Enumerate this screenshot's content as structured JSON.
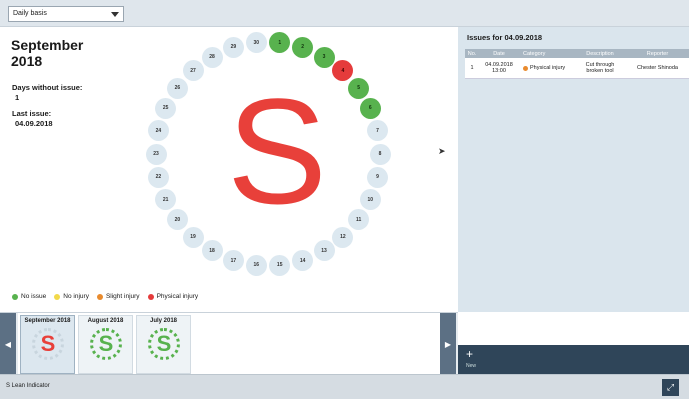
{
  "toolbar": {
    "period_select": "Daily basis"
  },
  "summary": {
    "month_line1": "September",
    "month_line2": "2018",
    "days_without_issue_label": "Days without issue:",
    "days_without_issue_value": "1",
    "last_issue_label": "Last issue:",
    "last_issue_value": "04.09.2018",
    "big_letter": "S"
  },
  "days": [
    {
      "n": "1",
      "status": "green"
    },
    {
      "n": "2",
      "status": "green"
    },
    {
      "n": "3",
      "status": "green"
    },
    {
      "n": "4",
      "status": "red"
    },
    {
      "n": "5",
      "status": "green"
    },
    {
      "n": "6",
      "status": "green"
    },
    {
      "n": "7",
      "status": "none"
    },
    {
      "n": "8",
      "status": "none"
    },
    {
      "n": "9",
      "status": "none"
    },
    {
      "n": "10",
      "status": "none"
    },
    {
      "n": "11",
      "status": "none"
    },
    {
      "n": "12",
      "status": "none"
    },
    {
      "n": "13",
      "status": "none"
    },
    {
      "n": "14",
      "status": "none"
    },
    {
      "n": "15",
      "status": "none"
    },
    {
      "n": "16",
      "status": "none"
    },
    {
      "n": "17",
      "status": "none"
    },
    {
      "n": "18",
      "status": "none"
    },
    {
      "n": "19",
      "status": "none"
    },
    {
      "n": "20",
      "status": "none"
    },
    {
      "n": "21",
      "status": "none"
    },
    {
      "n": "22",
      "status": "none"
    },
    {
      "n": "23",
      "status": "none"
    },
    {
      "n": "24",
      "status": "none"
    },
    {
      "n": "25",
      "status": "none"
    },
    {
      "n": "26",
      "status": "none"
    },
    {
      "n": "27",
      "status": "none"
    },
    {
      "n": "28",
      "status": "none"
    },
    {
      "n": "29",
      "status": "none"
    },
    {
      "n": "30",
      "status": "none"
    }
  ],
  "legend": [
    {
      "label": "No issue",
      "color": "#58b24e"
    },
    {
      "label": "No injury",
      "color": "#f2d94a"
    },
    {
      "label": "Slight injury",
      "color": "#e98b2e"
    },
    {
      "label": "Physical injury",
      "color": "#e53b3b"
    }
  ],
  "issues": {
    "title": "Issues for 04.09.2018",
    "columns": [
      "No.",
      "Date",
      "Category",
      "Description",
      "Reporter"
    ],
    "rows": [
      {
        "no": "1",
        "date_line1": "04.09.2018",
        "date_line2": "13:00",
        "category": "Physical injury",
        "category_color": "#e98b2e",
        "description_line1": "Cut through",
        "description_line2": "broken tool",
        "reporter": "Chester Shinoda"
      }
    ]
  },
  "history": [
    {
      "label": "September 2018",
      "letter": "S",
      "selected": true
    },
    {
      "label": "August 2018",
      "letter": "S",
      "selected": false
    },
    {
      "label": "July 2018",
      "letter": "S",
      "selected": false
    }
  ],
  "new_button": {
    "icon": "+",
    "label": "New"
  },
  "statusbar": {
    "app_name": "S Lean Indicator",
    "expand_icon": "expand-icon"
  }
}
